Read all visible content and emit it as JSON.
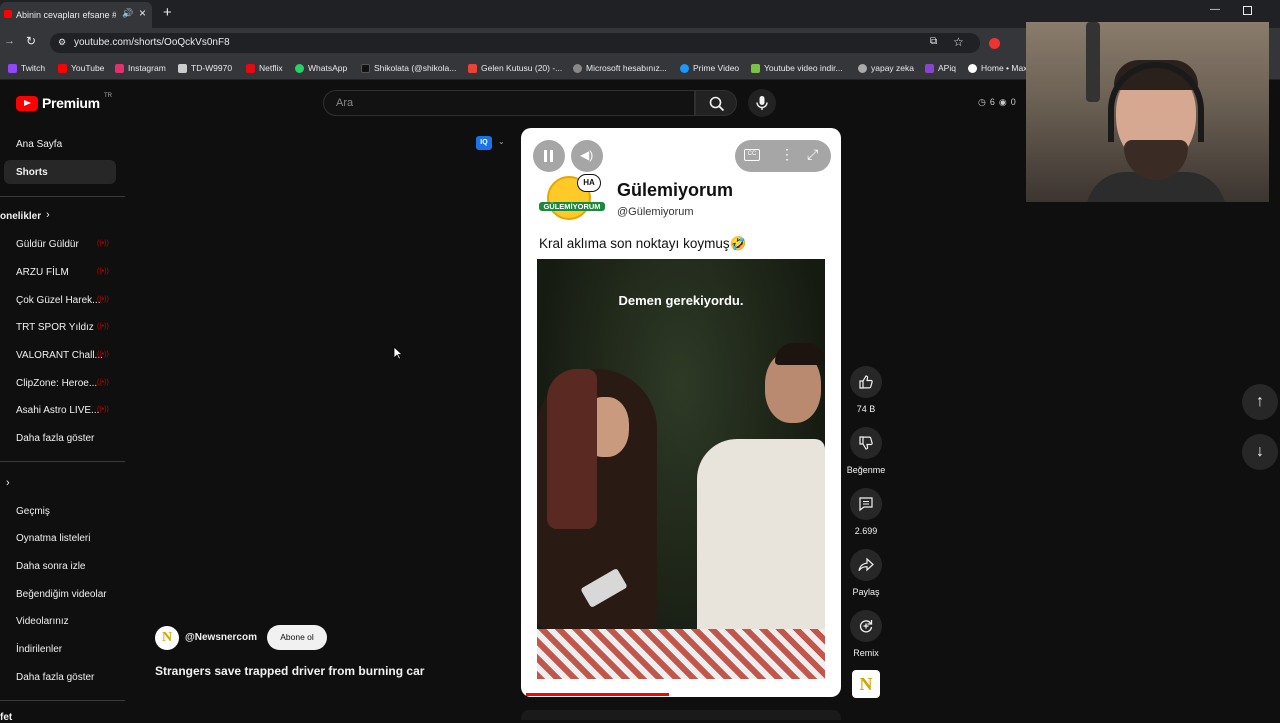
{
  "browser": {
    "tab_title": "Abinin cevapları efsane #kc",
    "url": "youtube.com/shorts/OoQckVs0nF8",
    "bookmarks": [
      {
        "label": "Twitch",
        "color": "#9146ff"
      },
      {
        "label": "YouTube",
        "color": "#ff0000"
      },
      {
        "label": "Instagram",
        "color": "#e1306c"
      },
      {
        "label": "TD-W9970",
        "color": "#cccccc"
      },
      {
        "label": "Netflix",
        "color": "#e50914"
      },
      {
        "label": "WhatsApp",
        "color": "#25d366"
      },
      {
        "label": "Shikolata (@shikola...",
        "color": "#111111"
      },
      {
        "label": "Gelen Kutusu (20) -...",
        "color": "#ea4335"
      },
      {
        "label": "Microsoft hesabınız...",
        "color": "#888888"
      },
      {
        "label": "Prime Video",
        "color": "#1a98ff"
      },
      {
        "label": "Youtube video indir...",
        "color": "#7cc144"
      },
      {
        "label": "yapay zeka",
        "color": "#aaaaaa"
      },
      {
        "label": "APiq",
        "color": "#8844cc"
      },
      {
        "label": "Home • Max",
        "color": "#ffffff"
      }
    ]
  },
  "youtube": {
    "logo_text": "Premium",
    "region": "TR",
    "search_placeholder": "Ara",
    "header_counts": {
      "a": "6",
      "b": "0"
    },
    "sidebar": {
      "home": "Ana Sayfa",
      "shorts": "Shorts",
      "subs_header": "onelikler",
      "subscriptions": [
        {
          "label": "Güldür Güldür"
        },
        {
          "label": "ARZU FİLM"
        },
        {
          "label": "Çok Güzel Harek..."
        },
        {
          "label": "TRT SPOR Yıldız"
        },
        {
          "label": "VALORANT Chall..."
        },
        {
          "label": "ClipZone: Heroe..."
        },
        {
          "label": "Asahi Astro LIVE..."
        }
      ],
      "show_more_1": "Daha fazla göster",
      "you_items": [
        "Geçmiş",
        "Oynatma listeleri",
        "Daha sonra izle",
        "Beğendiğim videolar",
        "Videolarınız",
        "İndirilenler"
      ],
      "show_more_2": "Daha fazla göster",
      "bottom_partial": "fet"
    },
    "short": {
      "badge": "HA",
      "logo_text": "GÜLEMİYORUM",
      "channel_name": "Gülemiyorum",
      "channel_handle": "@Gülemiyorum",
      "post_text": "Kral aklıma son noktayı koymuş🤣",
      "video_caption": "Demen gerekiyordu.",
      "progress": 0.46
    },
    "actions": {
      "like_count": "74 B",
      "dislike_label": "Beğenme",
      "comments_count": "2.699",
      "share_label": "Paylaş",
      "remix_label": "Remix",
      "channel_icon_letter": "N"
    },
    "next_short": {
      "avatar_letter": "N",
      "channel": "@Newsnercom",
      "subscribe_label": "Abone ol",
      "title": "Strangers save trapped driver from burning car"
    }
  }
}
